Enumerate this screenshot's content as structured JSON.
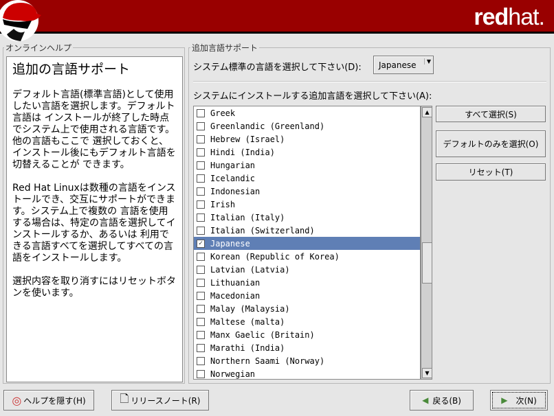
{
  "header": {
    "brand_bold": "red",
    "brand_light": "hat."
  },
  "help": {
    "legend": "オンラインヘルプ",
    "title": "追加の言語サポート",
    "paragraphs": [
      "デフォルト言語(標準言語)として使用したい言語を選択します。デフォルト言語は インストールが終了した時点でシステム上で使用される言語です。他の言語もここで 選択しておくと、インストール後にもデフォルト言語を切替えることが できます。",
      "Red Hat Linuxは数種の言語をインストールでき、交互にサポートができます。システム上で複数の 言語を使用する場合は、特定の言語を選択してインストールするか、あるいは 利用できる言語すべてを選択してすべての言語をインストールします。",
      "選択内容を取り消すにはリセットボタンを使います。"
    ]
  },
  "main": {
    "legend": "追加言語サポート",
    "default_label": "システム標準の言語を選択して下さい(D):",
    "default_value": "Japanese",
    "additional_label": "システムにインストールする追加言語を選択して下さい(A):",
    "languages": [
      {
        "name": "Greek",
        "checked": false
      },
      {
        "name": "Greenlandic (Greenland)",
        "checked": false
      },
      {
        "name": "Hebrew (Israel)",
        "checked": false
      },
      {
        "name": "Hindi (India)",
        "checked": false
      },
      {
        "name": "Hungarian",
        "checked": false
      },
      {
        "name": "Icelandic",
        "checked": false
      },
      {
        "name": "Indonesian",
        "checked": false
      },
      {
        "name": "Irish",
        "checked": false
      },
      {
        "name": "Italian (Italy)",
        "checked": false
      },
      {
        "name": "Italian (Switzerland)",
        "checked": false
      },
      {
        "name": "Japanese",
        "checked": true,
        "selected": true
      },
      {
        "name": "Korean (Republic of Korea)",
        "checked": false
      },
      {
        "name": "Latvian (Latvia)",
        "checked": false
      },
      {
        "name": "Lithuanian",
        "checked": false
      },
      {
        "name": "Macedonian",
        "checked": false
      },
      {
        "name": "Malay (Malaysia)",
        "checked": false
      },
      {
        "name": "Maltese (malta)",
        "checked": false
      },
      {
        "name": "Manx Gaelic (Britain)",
        "checked": false
      },
      {
        "name": "Marathi (India)",
        "checked": false
      },
      {
        "name": "Northern Saami (Norway)",
        "checked": false
      },
      {
        "name": "Norwegian",
        "checked": false
      }
    ],
    "select_all": "すべて選択(S)",
    "default_only": "デフォルトのみを選択(O)",
    "reset": "リセット(T)"
  },
  "footer": {
    "hide_help": "ヘルプを隠す(H)",
    "release_notes": "リリースノート(R)",
    "back": "戻る(B)",
    "next": "次(N)"
  },
  "colors": {
    "header": "#990000",
    "selection": "#5f7fb5"
  }
}
